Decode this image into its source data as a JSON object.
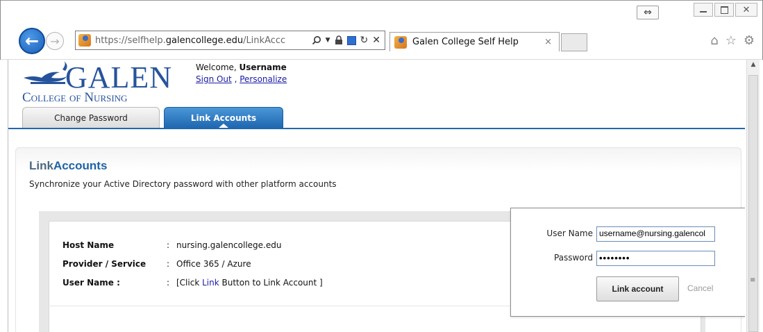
{
  "browser": {
    "url_prefix": "https://selfhelp.",
    "url_domain": "galencollege.edu",
    "url_path": "/LinkAccc",
    "tab_title": "Galen College Self Help",
    "tab_close": "×"
  },
  "header": {
    "logo_top": "GALEN",
    "logo_bottom": "College of Nursing",
    "welcome_prefix": "Welcome, ",
    "username": "Username",
    "sign_out": "Sign Out",
    "separator": " , ",
    "personalize": "Personalize"
  },
  "tabs": [
    {
      "label": "Change Password",
      "active": false
    },
    {
      "label": "Link Accounts",
      "active": true
    }
  ],
  "main": {
    "heading_plain": "Link",
    "heading_accent": "Accounts",
    "subtitle": "Synchronize your Active Directory password with other platform accounts",
    "details": [
      {
        "label": "Host Name",
        "colon": ":",
        "value": "nursing.galencollege.edu"
      },
      {
        "label": "Provider / Service",
        "colon": ":",
        "value": "Office 365 / Azure"
      },
      {
        "label": "User Name :",
        "colon": ":",
        "value_prefix": "[Click ",
        "value_link": "Link",
        "value_suffix": " Button to Link Account ]"
      }
    ]
  },
  "popup": {
    "username_label": "User Name",
    "username_value": "username@nursing.galencol",
    "password_label": "Password",
    "password_value": "••••••••",
    "link_button": "Link account",
    "cancel": "Cancel"
  },
  "colors": {
    "accent_blue": "#1f67b0",
    "logo_blue": "#26539b",
    "link_blue": "#1a1aa8"
  },
  "icons": [
    "back-arrow-icon",
    "forward-arrow-icon",
    "search-icon",
    "lock-icon",
    "refresh-icon",
    "stop-icon",
    "home-icon",
    "star-icon",
    "gear-icon"
  ]
}
